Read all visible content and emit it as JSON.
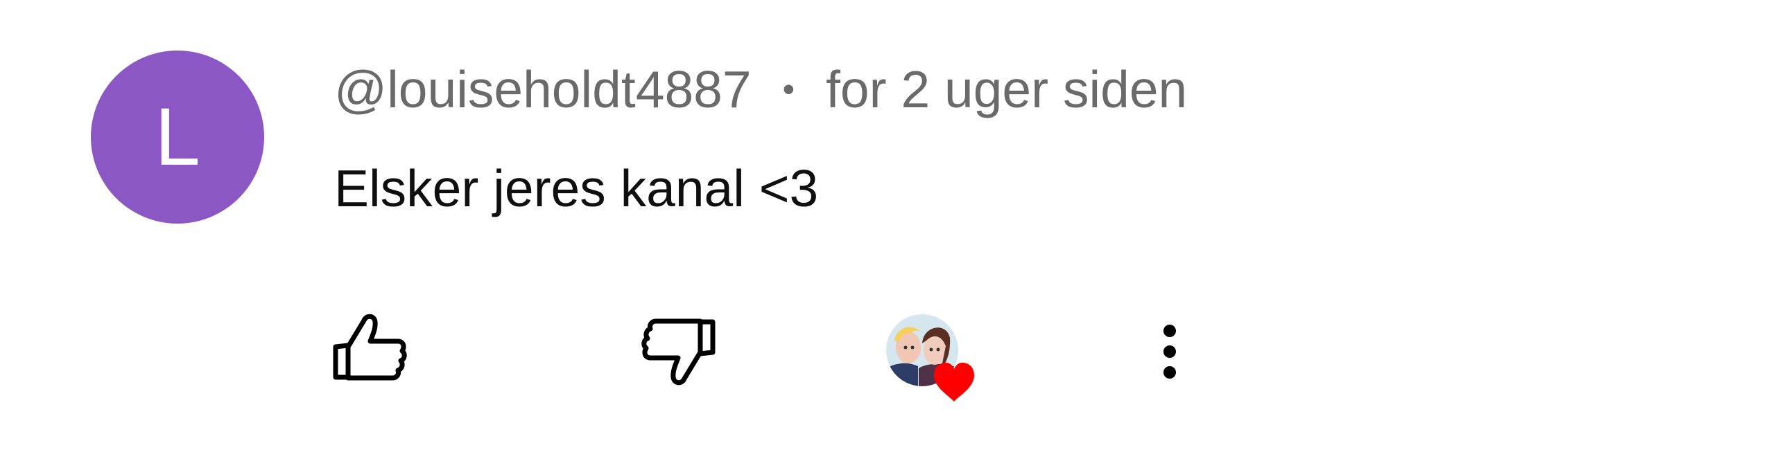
{
  "comment": {
    "avatar_letter": "L",
    "author": "@louiseholdt4887",
    "separator": "•",
    "timestamp": "for 2 uger siden",
    "text": "Elsker jeres kanal <3"
  },
  "actions": {
    "like_icon": "thumb-up-icon",
    "dislike_icon": "thumb-down-icon",
    "creator_heart_icon": "creator-heart-icon",
    "more_icon": "more-vertical-icon"
  },
  "colors": {
    "avatar": "#8b57c4",
    "meta_text": "#6a6a6a",
    "body_text": "#0f0f0f",
    "heart": "#ff0000"
  }
}
